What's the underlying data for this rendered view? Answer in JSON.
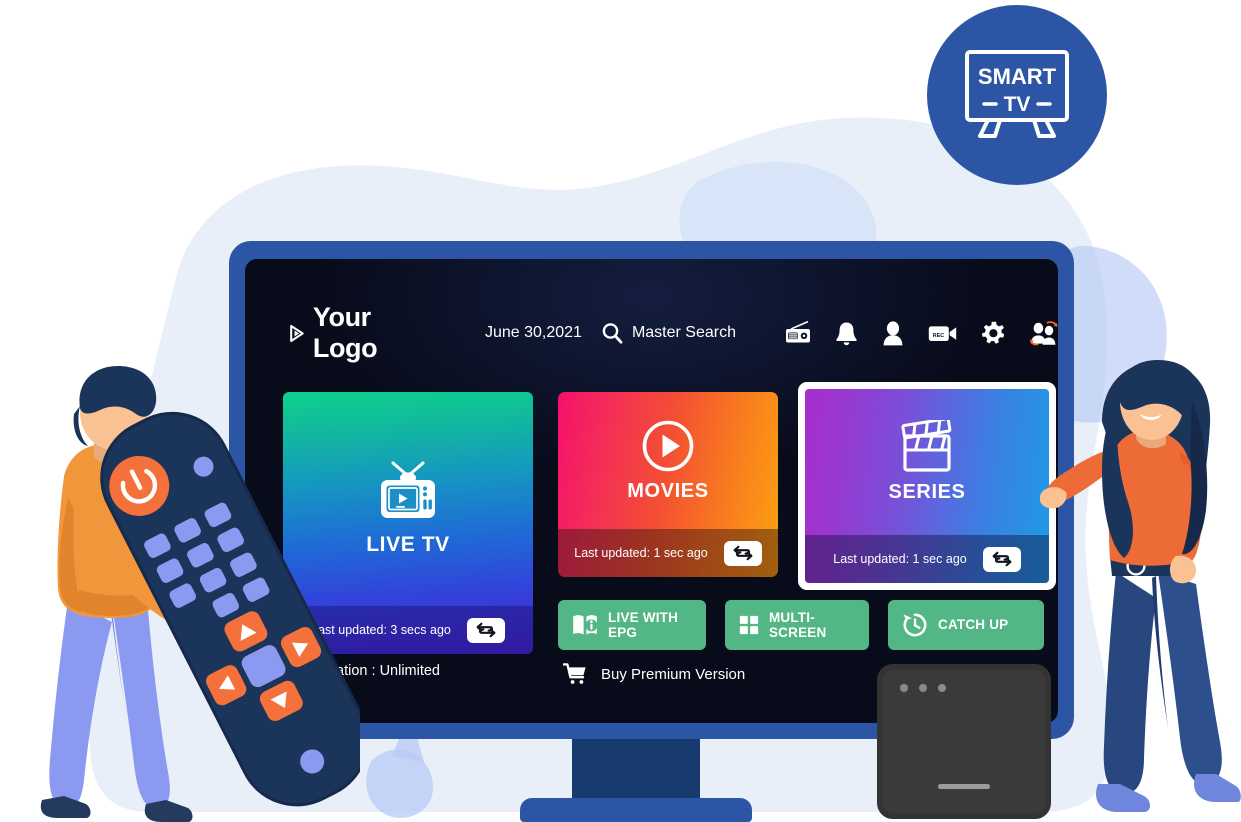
{
  "badge": {
    "line1": "SMART",
    "line2": "TV",
    "color": "#2C56A5",
    "icon": "tv-outline-icon"
  },
  "header": {
    "logo_text": "Your Logo",
    "logo_icon": "play-triangle-icon",
    "date": "June 30,2021",
    "search_label": "Master Search",
    "search_icon": "search-icon",
    "icons": [
      {
        "name": "radio-icon",
        "label": "Radio"
      },
      {
        "name": "bell-icon",
        "label": "Notifications"
      },
      {
        "name": "user-icon",
        "label": "Account"
      },
      {
        "name": "rec-camera-icon",
        "label": "REC"
      },
      {
        "name": "gear-icon",
        "label": "Settings"
      },
      {
        "name": "switch-user-icon",
        "label": "Switch User"
      }
    ]
  },
  "tiles": {
    "live_tv": {
      "title": "LIVE TV",
      "icon": "retro-tv-icon",
      "updated": "Last updated: 3 secs ago",
      "refresh_icon": "refresh-swap-icon",
      "gradient_from": "#0ED18C",
      "gradient_to": "#4323CE",
      "selected": false
    },
    "movies": {
      "title": "MOVIES",
      "icon": "play-circle-icon",
      "updated": "Last updated: 1 sec ago",
      "refresh_icon": "refresh-swap-icon",
      "gradient_from": "#F5106A",
      "gradient_to": "#FBA212",
      "selected": false
    },
    "series": {
      "title": "SERIES",
      "icon": "clapperboard-icon",
      "updated": "Last updated: 1 sec ago",
      "refresh_icon": "refresh-swap-icon",
      "gradient_from": "#A72ECB",
      "gradient_to": "#1E9BE6",
      "selected": true
    }
  },
  "quick_buttons": [
    {
      "label": "LIVE WITH\nEPG",
      "line1": "LIVE WITH",
      "line2": "EPG",
      "icon": "epg-book-icon"
    },
    {
      "label": "MULTI-SCREEN",
      "line1": "MULTI-SCREEN",
      "line2": "",
      "icon": "grid-squares-icon"
    },
    {
      "label": "CATCH UP",
      "line1": "CATCH UP",
      "line2": "",
      "icon": "clock-rewind-icon"
    }
  ],
  "footer": {
    "expiration": "Expiration : Unlimited",
    "buy_label": "Buy Premium Version",
    "cart_icon": "shopping-cart-icon"
  },
  "illustration": {
    "left_character": "man-holding-remote",
    "right_character": "woman-presenting",
    "device": "set-top-box",
    "remote": "tv-remote-control"
  },
  "colors": {
    "bezel": "#2C56A5",
    "screen": "#080B1A",
    "green_button": "#53B685",
    "blob": "#E8EFF9",
    "accent_periwinkle": "#B9CAF5",
    "orange": "#F07E3E",
    "navy": "#1B3459"
  }
}
